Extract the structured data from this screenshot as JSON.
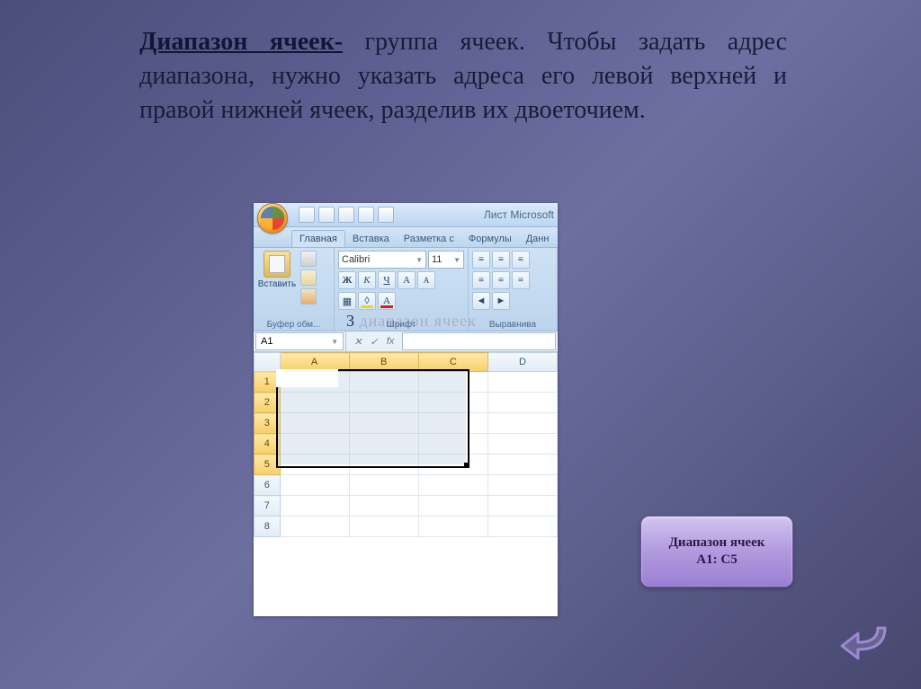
{
  "text": {
    "term": "Диапазон ячеек-",
    "definition": " группа ячеек. Чтобы задать адрес диапазона, нужно указать адреса его левой верхней и правой нижней ячеек,  разделив их двоеточием."
  },
  "callout": {
    "line1": "Диапазон ячеек",
    "line2": "А1: С5"
  },
  "overlay": {
    "number": "3",
    "faint": " диапазон ячеек"
  },
  "excel": {
    "title": "Лист Microsoft",
    "tabs": [
      "Главная",
      "Вставка",
      "Разметка с",
      "Формулы",
      "Данн"
    ],
    "ribbon": {
      "paste": "Вставить",
      "group_clip": "Буфер обм...",
      "font_name": "Calibri",
      "font_size": "11",
      "group_font": "Шрифт",
      "group_align": "Выравнива"
    },
    "name_box": "A1",
    "fx": "fx",
    "columns": [
      "A",
      "B",
      "C",
      "D"
    ],
    "rows": [
      "1",
      "2",
      "3",
      "4",
      "5",
      "6",
      "7",
      "8"
    ],
    "selection": "A1:C5"
  }
}
